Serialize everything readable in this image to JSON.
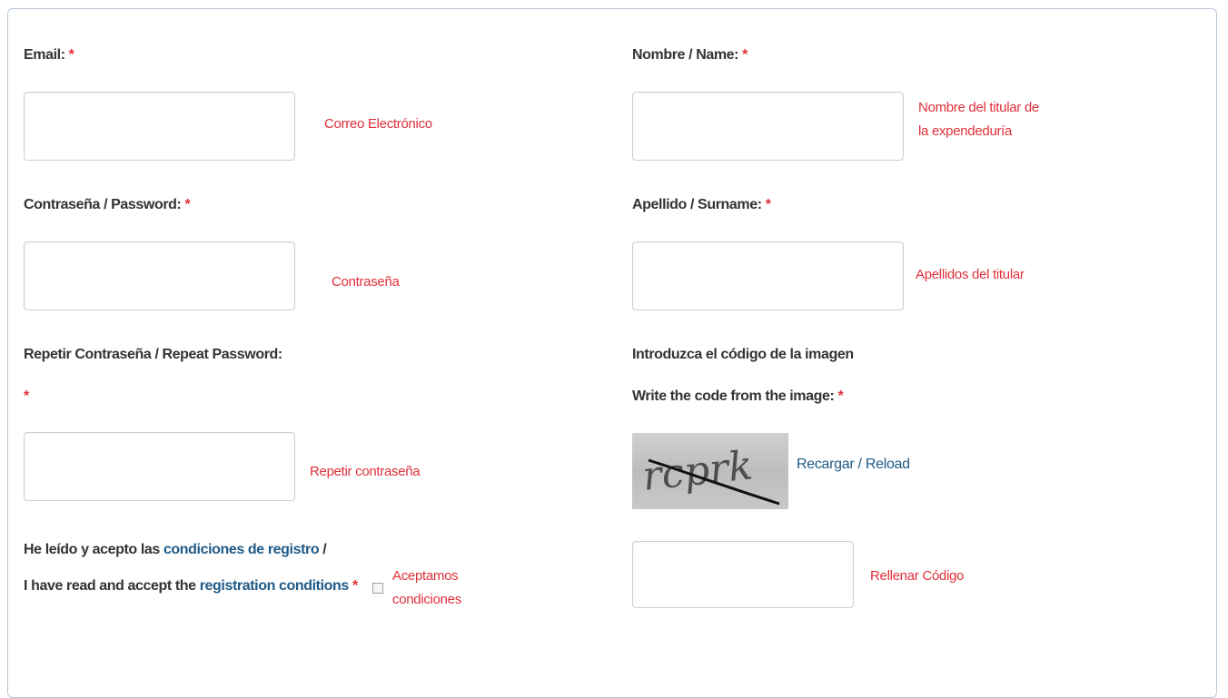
{
  "required_mark": "*",
  "left": {
    "email": {
      "label": "Email:",
      "hint": "Correo Electrónico",
      "value": ""
    },
    "password": {
      "label": "Contraseña / Password:",
      "hint": "Contraseña",
      "value": ""
    },
    "repeat_password": {
      "label": "Repetir Contraseña / Repeat Password:",
      "hint": "Repetir contraseña",
      "value": ""
    },
    "terms": {
      "line1_prefix": "He leído y acepto las",
      "line1_link": "condiciones de registro",
      "line1_suffix": "/",
      "line2_prefix": "I have read and accept the",
      "line2_link": "registration conditions",
      "hint_line1": "Aceptamos",
      "hint_line2": "condiciones",
      "checked": false
    }
  },
  "right": {
    "name": {
      "label": "Nombre / Name:",
      "hint_line1": "Nombre del titular de",
      "hint_line2": "la expendeduría",
      "value": ""
    },
    "surname": {
      "label": "Apellido / Surname:",
      "hint": "Apellidos del titular",
      "value": ""
    },
    "captcha": {
      "label_line1": "Introduzca el código de la imagen",
      "label_line2": "Write the code from the image:",
      "image_text": "rcprk",
      "reload_link": "Recargar / Reload",
      "hint": "Rellenar Código",
      "value": ""
    }
  },
  "colors": {
    "required": "#e0303a",
    "hint": "#e0303a",
    "link": "#1f5a86",
    "border": "#b7c8d6"
  }
}
